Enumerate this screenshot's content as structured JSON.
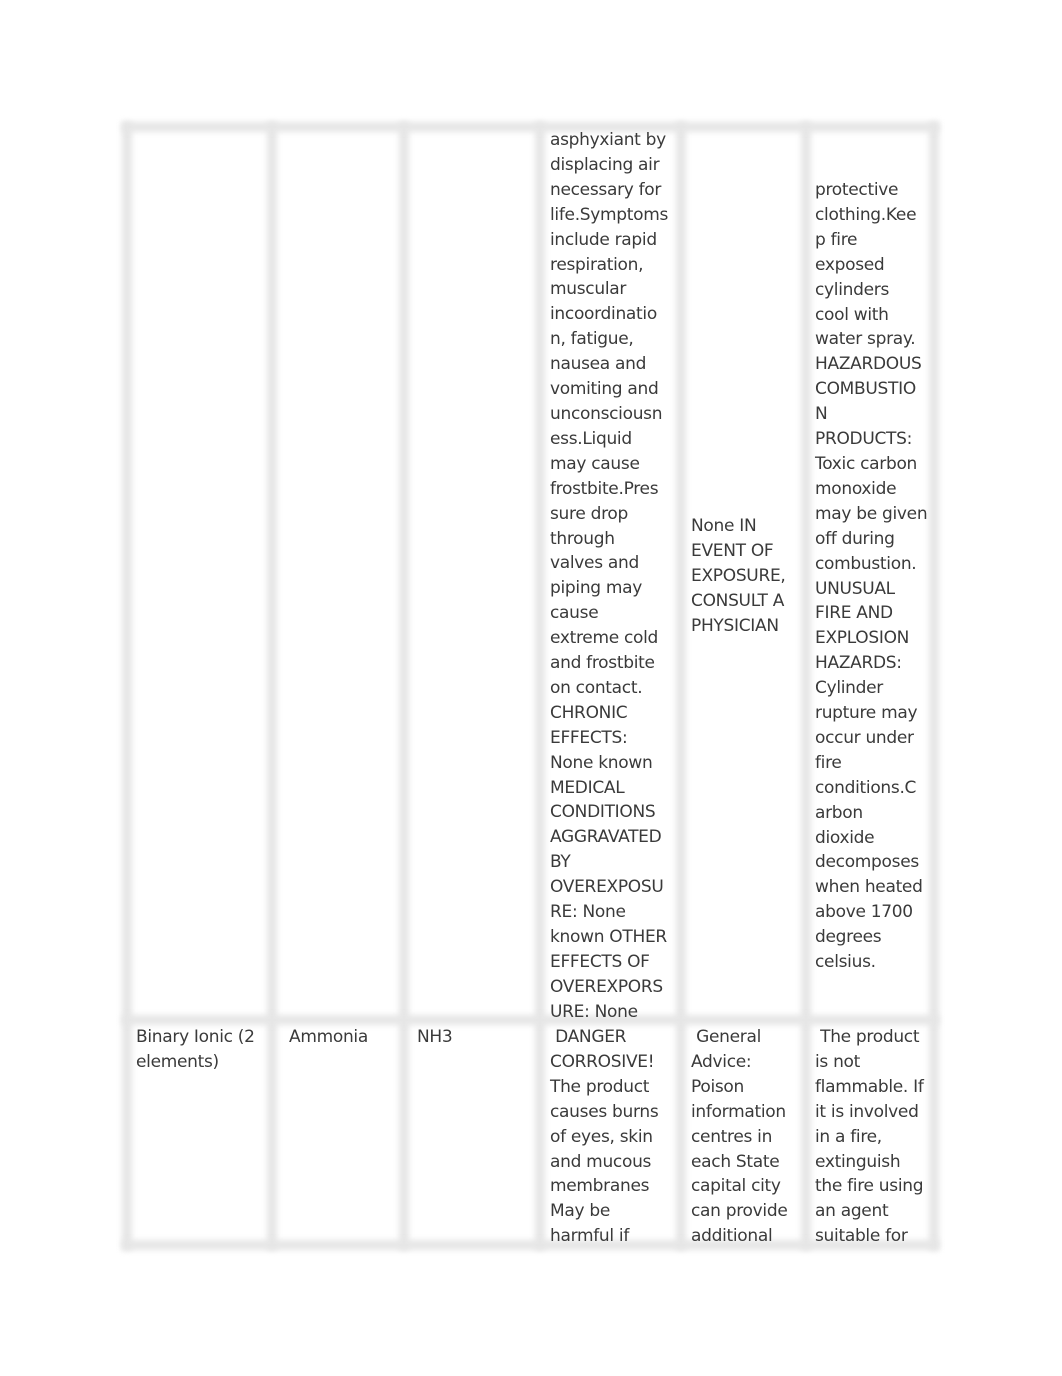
{
  "table": {
    "rows": [
      {
        "type": "",
        "name": "",
        "formula": "",
        "health_hazards": "asphyxiant by\ndisplacing air\nnecessary for\nlife.Symptoms\ninclude rapid\nrespiration,\nmuscular\nincoordinatio\nn, fatigue,\nnausea and\nvomiting and\nunconsciousn\ness.Liquid\nmay cause\nfrostbite.Pres\nsure drop\nthrough\nvalves and\npiping may\ncause\nextreme cold\nand frostbite\non contact.\nCHRONIC\nEFFECTS:\nNone known\nMEDICAL\nCONDITIONS\nAGGRAVATED\nBY\nOVEREXPOSU\nRE: None\nknown OTHER\nEFFECTS OF\nOVEREXPORS\nURE: None",
        "first_aid": "None IN\nEVENT OF\nEXPOSURE,\nCONSULT A\nPHYSICIAN",
        "fire_hazards": "protective\nclothing.Kee\np fire\nexposed\ncylinders\ncool with\nwater spray.\nHAZARDOUS\nCOMBUSTIO\nN\nPRODUCTS:\nToxic carbon\nmonoxide\nmay be given\noff during\ncombustion.\nUNUSUAL\nFIRE AND\nEXPLOSION\nHAZARDS:\nCylinder\nrupture may\noccur under\nfire\nconditions.C\narbon\ndioxide\ndecomposes\nwhen heated\nabove 1700\ndegrees\ncelsius."
      },
      {
        "type": "Binary Ionic (2\nelements)",
        "name": "Ammonia",
        "formula": "NH3",
        "health_hazards": " DANGER\nCORROSIVE!\nThe product\ncauses burns\nof eyes, skin\nand mucous\nmembranes\nMay be\nharmful if",
        "first_aid": " General\nAdvice:\nPoison\ninformation\ncentres in\neach State\ncapital city\ncan provide\nadditional",
        "fire_hazards": " The product\nis not\nflammable. If\nit is involved\nin a fire,\nextinguish\nthe fire using\nan agent\nsuitable for"
      }
    ]
  }
}
